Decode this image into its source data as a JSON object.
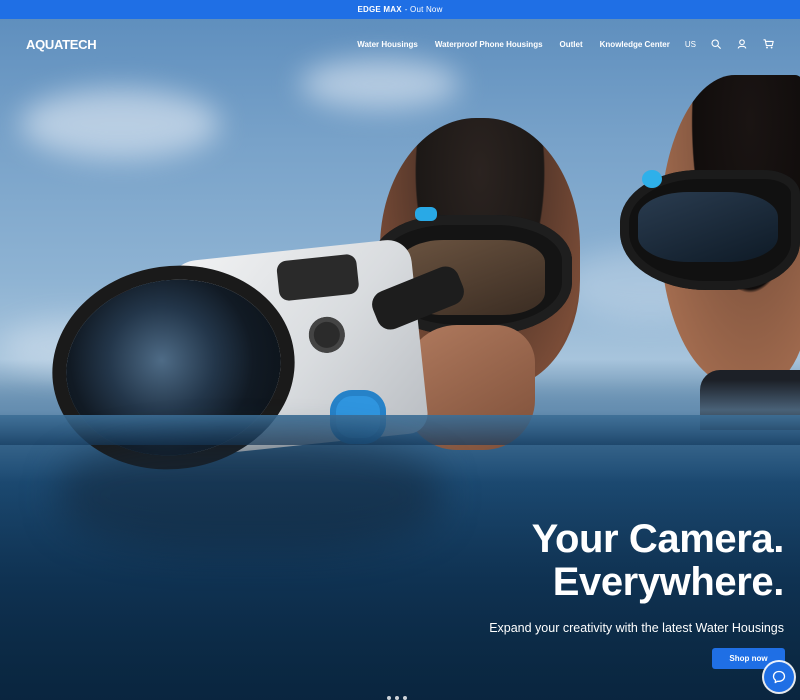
{
  "announcement": {
    "bold": "EDGE MAX",
    "rest": "- Out Now"
  },
  "header": {
    "logo": "AQUATECH",
    "nav": [
      {
        "label": "Water Housings"
      },
      {
        "label": "Waterproof Phone Housings"
      },
      {
        "label": "Outlet"
      },
      {
        "label": "Knowledge Center"
      }
    ],
    "locale": "US",
    "icons": [
      "search-icon",
      "account-icon",
      "cart-icon"
    ]
  },
  "hero": {
    "headline_line1": "Your Camera.",
    "headline_line2": "Everywhere.",
    "subtext": "Expand your creativity with the latest Water Housings",
    "cta": "Shop now"
  },
  "widgets": {
    "chat_icon": "chat-icon"
  },
  "colors": {
    "accent": "#1f6fe5",
    "text": "#ffffff"
  }
}
